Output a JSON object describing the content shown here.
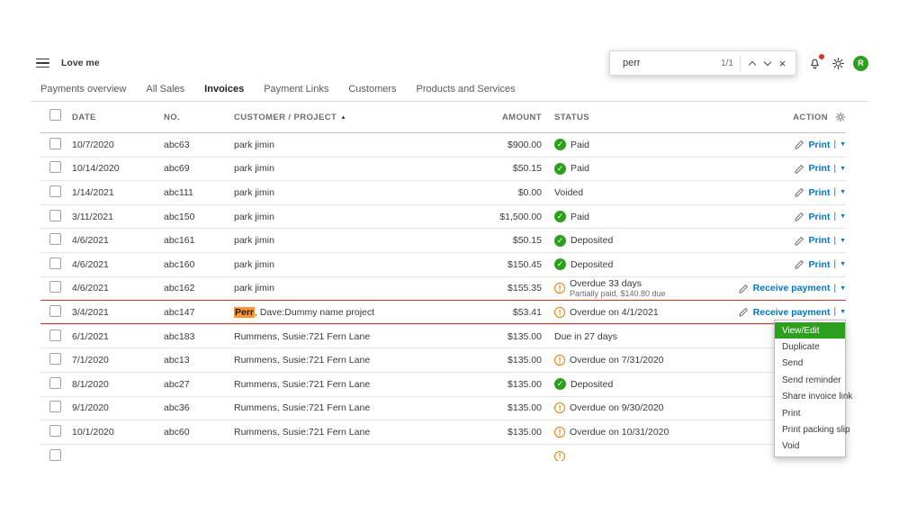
{
  "topbar": {
    "company_name": "Love me",
    "find_bar": {
      "value": "perr",
      "counter": "1/1"
    },
    "avatar_letter": "R"
  },
  "tabs": [
    {
      "label": "Payments overview",
      "active": false
    },
    {
      "label": "All Sales",
      "active": false
    },
    {
      "label": "Invoices",
      "active": true
    },
    {
      "label": "Payment Links",
      "active": false
    },
    {
      "label": "Customers",
      "active": false
    },
    {
      "label": "Products and Services",
      "active": false
    }
  ],
  "table": {
    "headers": {
      "date": "DATE",
      "no": "NO.",
      "customer": "CUSTOMER / PROJECT",
      "amount": "AMOUNT",
      "status": "STATUS",
      "action": "ACTION"
    },
    "rows": [
      {
        "date": "10/7/2020",
        "no": "abc63",
        "customer": "park jimin",
        "amount": "$900.00",
        "status": "Paid",
        "icon": "paid",
        "action": "Print"
      },
      {
        "date": "10/14/2020",
        "no": "abc69",
        "customer": "park jimin",
        "amount": "$50.15",
        "status": "Paid",
        "icon": "paid",
        "action": "Print"
      },
      {
        "date": "1/14/2021",
        "no": "abc111",
        "customer": "park jimin",
        "amount": "$0.00",
        "status": "Voided",
        "icon": "none",
        "action": "Print"
      },
      {
        "date": "3/11/2021",
        "no": "abc150",
        "customer": "park jimin",
        "amount": "$1,500.00",
        "status": "Paid",
        "icon": "paid",
        "action": "Print"
      },
      {
        "date": "4/6/2021",
        "no": "abc161",
        "customer": "park jimin",
        "amount": "$50.15",
        "status": "Deposited",
        "icon": "paid",
        "action": "Print"
      },
      {
        "date": "4/6/2021",
        "no": "abc160",
        "customer": "park jimin",
        "amount": "$150.45",
        "status": "Deposited",
        "icon": "paid",
        "action": "Print"
      },
      {
        "date": "4/6/2021",
        "no": "abc162",
        "customer": "park jimin",
        "amount": "$155.35",
        "status": "Overdue 33 days",
        "status_sub": "Partially paid, $140.80 due",
        "icon": "overdue",
        "action": "Receive payment"
      },
      {
        "date": "3/4/2021",
        "no": "abc147",
        "customer_match": "Perr",
        "customer_rest": ", Dave:Dummy name project",
        "amount": "$53.41",
        "status": "Overdue on 4/1/2021",
        "icon": "overdue",
        "action": "Receive payment",
        "highlighted": true
      },
      {
        "date": "6/1/2021",
        "no": "abc183",
        "customer": "Rummens, Susie:721 Fern Lane",
        "amount": "$135.00",
        "status": "Due in 27 days",
        "icon": "none",
        "action": ""
      },
      {
        "date": "7/1/2020",
        "no": "abc13",
        "customer": "Rummens, Susie:721 Fern Lane",
        "amount": "$135.00",
        "status": "Overdue on 7/31/2020",
        "icon": "overdue",
        "action": ""
      },
      {
        "date": "8/1/2020",
        "no": "abc27",
        "customer": "Rummens, Susie:721 Fern Lane",
        "amount": "$135.00",
        "status": "Deposited",
        "icon": "paid",
        "action": ""
      },
      {
        "date": "9/1/2020",
        "no": "abc36",
        "customer": "Rummens, Susie:721 Fern Lane",
        "amount": "$135.00",
        "status": "Overdue on 9/30/2020",
        "icon": "overdue",
        "action": ""
      },
      {
        "date": "10/1/2020",
        "no": "abc60",
        "customer": "Rummens, Susie:721 Fern Lane",
        "amount": "$135.00",
        "status": "Overdue on 10/31/2020",
        "icon": "overdue",
        "action": ""
      },
      {
        "partial": true,
        "date": "",
        "no": "",
        "customer": "",
        "amount": "",
        "status": "",
        "icon": "overdue",
        "action": ""
      }
    ]
  },
  "action_menu": {
    "items": [
      {
        "label": "View/Edit",
        "selected": true
      },
      {
        "label": "Duplicate"
      },
      {
        "label": "Send"
      },
      {
        "label": "Send reminder"
      },
      {
        "label": "Share invoice link"
      },
      {
        "label": "Print"
      },
      {
        "label": "Print packing slip"
      },
      {
        "label": "Void"
      }
    ]
  },
  "icons": {
    "sort_asc": "▲",
    "caret_down": "▼",
    "check": "✓",
    "warning": "!",
    "close": "×",
    "divider": "|"
  },
  "colors": {
    "brand_green": "#2ca01c",
    "link_blue": "#0077c5",
    "warning_orange": "#e87b00",
    "row_highlight_red": "#d4342a",
    "find_match_orange": "#ff9632"
  }
}
